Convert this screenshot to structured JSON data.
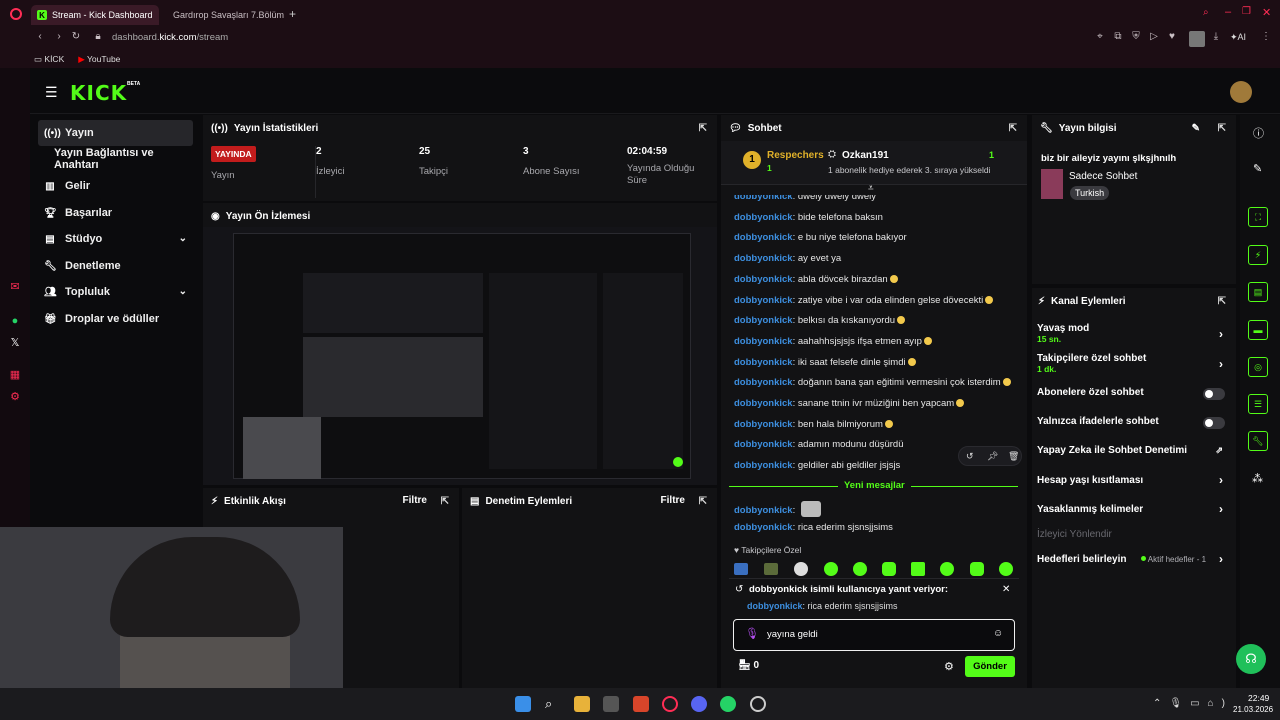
{
  "browser": {
    "tabs": [
      {
        "label": "Stream - Kick Dashboard"
      },
      {
        "label": "Gardırop Savaşları 7.Bölüm"
      }
    ],
    "url_prefix": "dashboard.",
    "url_domain": "kick.com",
    "url_path": "/stream",
    "bookmarks": [
      "KİCK",
      "YouTube"
    ],
    "ai_label": "AI"
  },
  "app": {
    "logo": "KICK",
    "beta": "BETA"
  },
  "nav": {
    "items": [
      {
        "label": "Yayın",
        "icon": "broadcast-icon"
      },
      {
        "label": "Yayın Bağlantısı ve Anahtarı",
        "icon": "link-icon"
      },
      {
        "label": "Gelir",
        "icon": "chart-icon"
      },
      {
        "label": "Başarılar",
        "icon": "trophy-icon"
      },
      {
        "label": "Stüdyo",
        "icon": "studio-icon"
      },
      {
        "label": "Denetleme",
        "icon": "wrench-icon"
      },
      {
        "label": "Topluluk",
        "icon": "people-icon"
      },
      {
        "label": "Droplar ve ödüller",
        "icon": "gift-icon"
      }
    ]
  },
  "stats": {
    "title": "Yayın İstatistikleri",
    "live_badge": "YAYINDA",
    "live_label": "Yayın",
    "viewers": {
      "value": "2",
      "label": "İzleyici"
    },
    "followers": {
      "value": "25",
      "label": "Takipçi"
    },
    "subs": {
      "value": "3",
      "label": "Abone Sayısı"
    },
    "duration": {
      "value": "02:04:59",
      "label": "Yayında Olduğu Süre"
    }
  },
  "preview": {
    "title": "Yayın Ön İzlemesi"
  },
  "activity": {
    "title": "Etkinlik Akışı",
    "filter": "Filtre"
  },
  "moderation": {
    "title": "Denetim Eylemleri",
    "filter": "Filtre"
  },
  "chat": {
    "title": "Sohbet",
    "pinned_rank": "1",
    "pinned_user": "Respechers",
    "pinned_count": "1",
    "pinned_gifter": "Ozkan191",
    "pinned_gift_count": "1",
    "pinned_text": "1 abonelik hediye ederek 3. sıraya yükseldi",
    "messages": [
      {
        "user": "dobbyonkick",
        "text": ": dwely dwely dwely"
      },
      {
        "user": "dobbyonkick",
        "text": ": bide telefona baksın"
      },
      {
        "user": "dobbyonkick",
        "text": ": e bu niye telefona bakıyor"
      },
      {
        "user": "dobbyonkick",
        "text": ": ay evet ya"
      },
      {
        "user": "dobbyonkick",
        "text": ": abla dövcek birazdan"
      },
      {
        "user": "dobbyonkick",
        "text": ": zatiye vibe i var oda elinden gelse dövecekti"
      },
      {
        "user": "dobbyonkick",
        "text": ": belkısı da kıskanıyordu"
      },
      {
        "user": "dobbyonkick",
        "text": ": aahahhsjsjsjs ifşa etmen ayıp"
      },
      {
        "user": "dobbyonkick",
        "text": ": iki saat felsefe dinle şimdi"
      },
      {
        "user": "dobbyonkick",
        "text": ": doğanın bana şan eğitimi vermesini çok isterdim"
      },
      {
        "user": "dobbyonkick",
        "text": ": sanane ttnin ivr müziğini ben yapcam"
      },
      {
        "user": "dobbyonkick",
        "text": ": ben hala bilmiyorum"
      },
      {
        "user": "dobbyonkick",
        "text": ": adamın modunu düşürdü"
      },
      {
        "user": "dobbyonkick",
        "text": ": geldiler abi geldiler jsjsjs"
      }
    ],
    "new_messages_label": "Yeni mesajlar",
    "after": [
      {
        "user": "dobbyonkick",
        "text": ":"
      },
      {
        "user": "dobbyonkick",
        "text": ": rica ederim sjsnsjjsims"
      }
    ],
    "followers_only_label": "Takipçilere Özel",
    "reply_header": "dobbyonkick isimli kullanıcıya yanıt veriyor:",
    "reply_user": "dobbyonkick",
    "reply_text": ": rica ederim sjsnsjjsims",
    "input_value": "yayına geldi",
    "points": "0",
    "send_label": "Gönder"
  },
  "info": {
    "title": "Yayın bilgisi",
    "stream_title": "biz bir aileyiz yayını şlkşjhnılh",
    "category": "Sadece Sohbet",
    "language": "Turkish"
  },
  "channel_actions": {
    "title": "Kanal Eylemleri",
    "slow_mode": {
      "label": "Yavaş mod",
      "value": "15 sn."
    },
    "followers_chat": {
      "label": "Takipçilere özel sohbet",
      "value": "1 dk."
    },
    "subs_chat": "Abonelere özel sohbet",
    "emote_chat": "Yalnızca ifadelerle sohbet",
    "ai_moderation": "Yapay Zeka ile Sohbet Denetimi",
    "age_restrict": "Hesap yaşı kısıtlaması",
    "banned_words": "Yasaklanmış kelimeler",
    "redirect": "İzleyici Yönlendir",
    "goals": "Hedefleri belirleyin",
    "goals_active": "Aktif hedefler - 1"
  },
  "taskbar": {
    "time": "22:49",
    "date": "21.03.2026"
  },
  "colors": {
    "brand": "#53fc18",
    "live": "#c21c1c",
    "username": "#3d8fe0"
  }
}
